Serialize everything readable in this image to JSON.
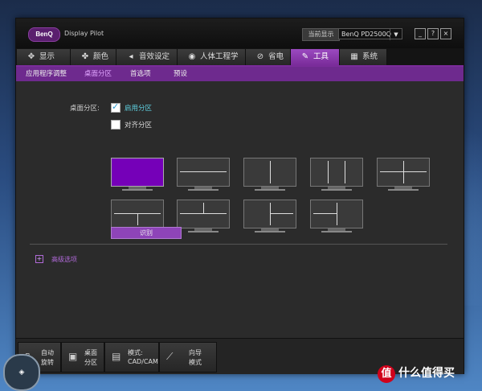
{
  "app": {
    "brand": "BenQ",
    "title": "Display Pilot"
  },
  "header": {
    "current_display_label": "当前显示",
    "monitor": "BenQ PD2500Q"
  },
  "window_buttons": [
    "_",
    "?",
    "×"
  ],
  "tabs": [
    {
      "icon": "✥",
      "label": "显示"
    },
    {
      "icon": "✤",
      "label": "颜色"
    },
    {
      "icon": "◂",
      "label": "音效设定"
    },
    {
      "icon": "◉",
      "label": "人体工程学"
    },
    {
      "icon": "⊘",
      "label": "省电"
    },
    {
      "icon": "✎",
      "label": "工具"
    },
    {
      "icon": "▦",
      "label": "系统"
    }
  ],
  "subtabs": [
    "应用程序调整",
    "桌面分区",
    "首选项",
    "预设"
  ],
  "desktop_partition": {
    "section_label": "桌面分区:",
    "enable_label": "启用分区",
    "enable_checked": true,
    "align_label": "对齐分区",
    "align_checked": false,
    "identify_label": "识别"
  },
  "advanced_label": "高级选项",
  "bottom_bar": [
    {
      "icon": "▯",
      "line1": "自动",
      "line2": "旋转"
    },
    {
      "icon": "▣",
      "line1": "桌面",
      "line2": "分区"
    },
    {
      "icon": "▤",
      "line1": "模式:",
      "line2": "CAD/CAM"
    },
    {
      "icon": "⟋",
      "line1": "向导",
      "line2": "模式"
    }
  ],
  "watermark": {
    "badge": "值",
    "text": "什么值得买"
  },
  "colors": {
    "accent": "#7a2c9a",
    "selected_layout": "#7500b8"
  }
}
